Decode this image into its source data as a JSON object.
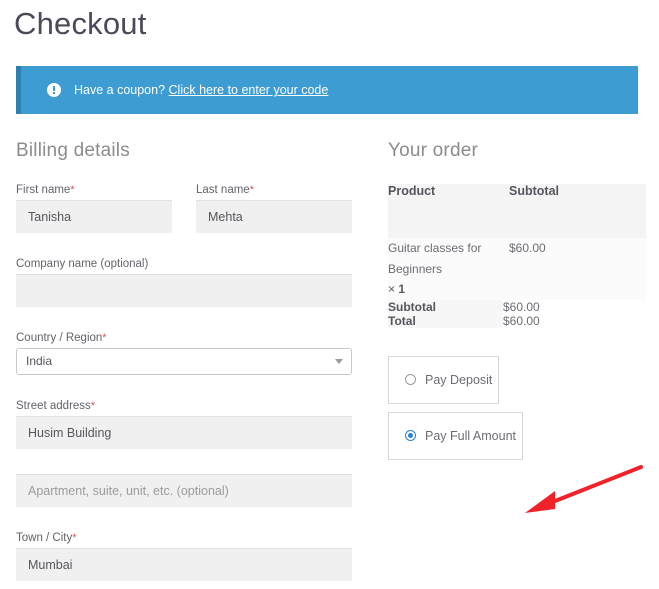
{
  "page": {
    "title": "Checkout"
  },
  "coupon": {
    "icon": "info-circle-icon",
    "text": "Have a coupon?",
    "link_label": "Click here to enter your code",
    "background_color": "#3d9cd2",
    "border_color": "#2f7fae"
  },
  "billing": {
    "heading": "Billing details",
    "fields": [
      {
        "name": "first-name",
        "label": "First name",
        "required": true,
        "value": "Tanisha",
        "placeholder": "",
        "type": "text"
      },
      {
        "name": "last-name",
        "label": "Last name",
        "required": true,
        "value": "Mehta",
        "placeholder": "",
        "type": "text"
      },
      {
        "name": "company-name",
        "label": "Company name (optional)",
        "required": false,
        "value": "",
        "placeholder": "",
        "type": "text"
      },
      {
        "name": "country-region",
        "label": "Country / Region",
        "required": true,
        "value": "India",
        "type": "select"
      },
      {
        "name": "street-address",
        "label": "Street address",
        "required": true,
        "value": "Husim Building",
        "placeholder": "",
        "type": "text"
      },
      {
        "name": "address-line-2",
        "label": "",
        "required": false,
        "value": "",
        "placeholder": "Apartment, suite, unit, etc. (optional)",
        "type": "text"
      },
      {
        "name": "town-city",
        "label": "Town / City",
        "required": true,
        "value": "Mumbai",
        "placeholder": "",
        "type": "text"
      }
    ],
    "required_marker": "*"
  },
  "order": {
    "heading": "Your order",
    "columns": [
      "Product",
      "Subtotal"
    ],
    "items": [
      {
        "name": "Guitar classes for Beginners",
        "quantity_prefix": "×",
        "quantity": "1",
        "subtotal": "$60.00"
      }
    ],
    "totals": [
      {
        "label": "Subtotal",
        "value": "$60.00"
      },
      {
        "label": "Total",
        "value": "$60.00"
      }
    ]
  },
  "payment": {
    "options": [
      {
        "name": "pay-deposit",
        "label": "Pay Deposit",
        "selected": false
      },
      {
        "name": "pay-full-amount",
        "label": "Pay Full Amount",
        "selected": true
      }
    ],
    "selected_color": "#2b7fd4"
  },
  "annotation": {
    "type": "arrow",
    "color": "#f2222a",
    "points_to": "pay-options"
  }
}
